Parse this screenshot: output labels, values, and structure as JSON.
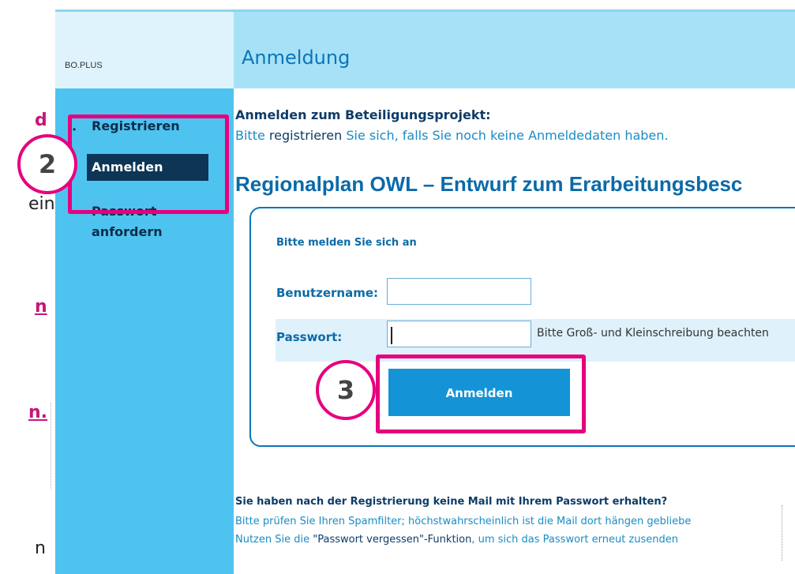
{
  "doc_fragments": {
    "line1": "d",
    "line2": "ein",
    "line3": "n",
    "line4": "n.",
    "line5": "n"
  },
  "sidebar": {
    "brand": "BO.PLUS",
    "items": [
      {
        "label": "Registrieren"
      },
      {
        "label": "Anmelden"
      },
      {
        "label": "Passwort"
      },
      {
        "label": "anfordern"
      }
    ]
  },
  "main": {
    "title": "Anmeldung",
    "intro_heading": "Anmelden zum Beteiligungsprojekt:",
    "intro_pre": "Bitte ",
    "intro_link": "registrieren",
    "intro_post": " Sie sich, falls Sie noch keine Anmeldedaten haben.",
    "project_title": "Regionalplan OWL – Entwurf zum Erarbeitungsbesc"
  },
  "login": {
    "hint": "Bitte melden Sie sich an",
    "username_label": "Benutzername:",
    "username_value": "",
    "password_label": "Passwort:",
    "password_value": "",
    "case_hint": "Bitte Groß- und Kleinschreibung beachten",
    "submit_label": "Anmelden"
  },
  "steps": {
    "step2": "2",
    "step3": "3"
  },
  "footer": {
    "heading": "Sie haben nach der Registrierung keine Mail mit Ihrem Passwort erhalten?",
    "line1": "Bitte prüfen Sie Ihren Spamfilter; höchstwahrscheinlich ist die Mail dort hängen gebliebe",
    "line2_pre": "Nutzen Sie die ",
    "line2_link": "\"Passwort vergessen\"-Funktion",
    "line2_post": ", um sich das Passwort erneut zusenden"
  },
  "colors": {
    "accent": "#e6007e",
    "primary": "#0b76b8",
    "sidebar": "#4fc3f0",
    "sidebar_active": "#0c3556"
  }
}
